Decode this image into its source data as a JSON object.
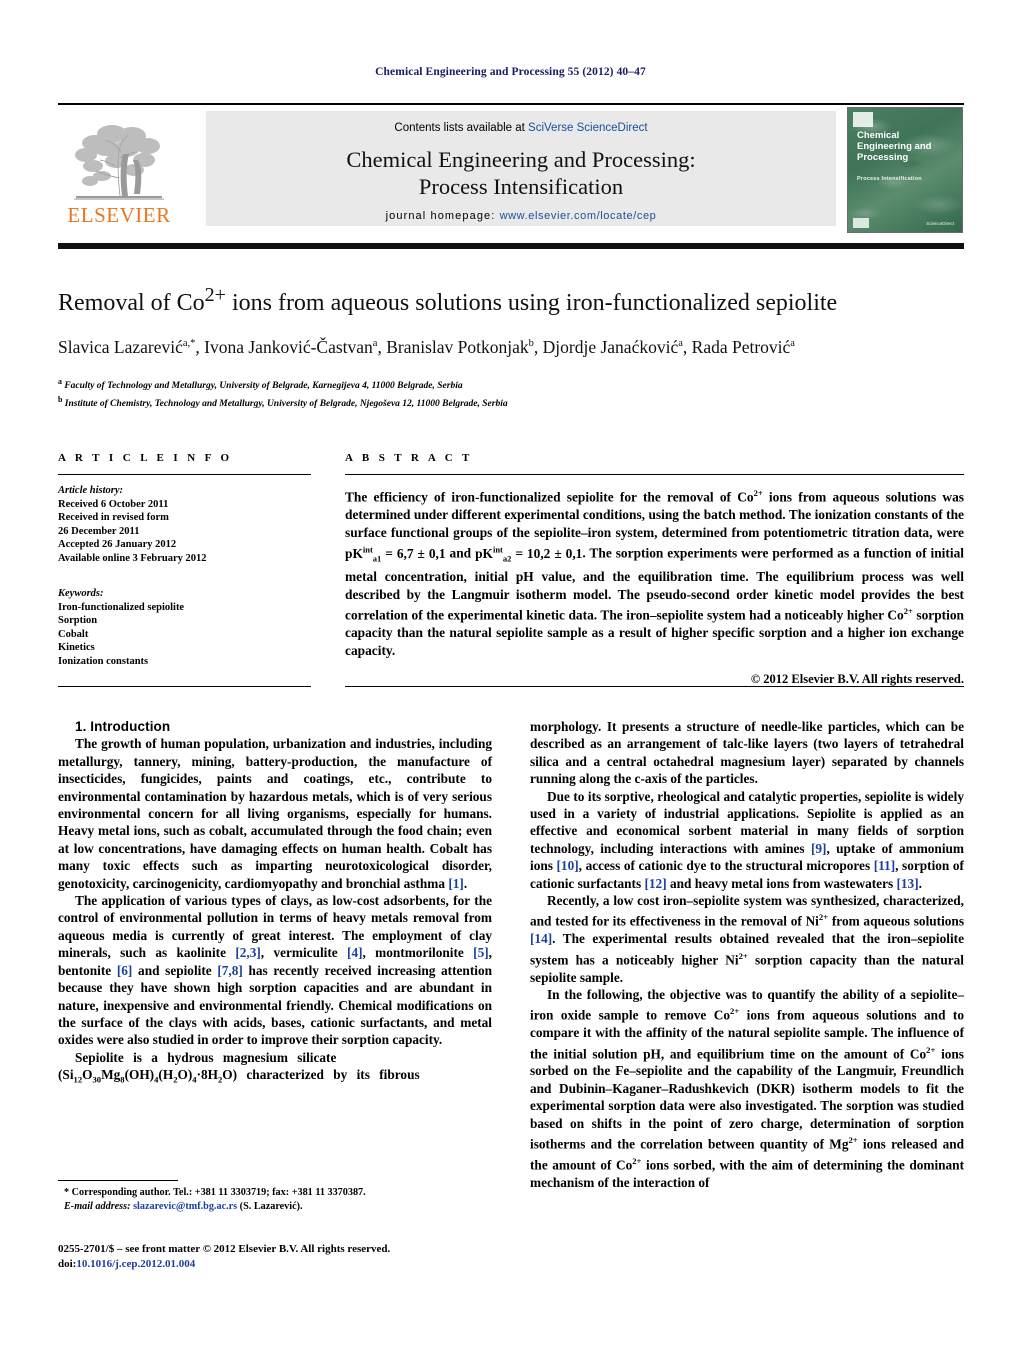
{
  "running_head": "Chemical Engineering and Processing 55 (2012) 40–47",
  "masthead": {
    "contents_prefix": "Contents lists available at ",
    "contents_link": "SciVerse ScienceDirect",
    "journal_title_line1": "Chemical Engineering and Processing:",
    "journal_title_line2": "Process Intensification",
    "homepage_label": "journal homepage:",
    "homepage_url": "www.elsevier.com/locate/cep",
    "publisher": "ELSEVIER",
    "cover": {
      "title": "Chemical Engineering and Processing",
      "subtitle": "Process Intensification",
      "footer": "ScienceDirect"
    }
  },
  "article": {
    "title_prefix": "Removal of Co",
    "title_sup": "2+",
    "title_suffix": " ions from aqueous solutions using iron-functionalized sepiolite",
    "authors": "Slavica Lazarević, Ivona Janković-Častvan, Branislav Potkonjak, Djordje Janaćković, Rada Petrović",
    "authors_html": "Slavica Lazarević a,*, Ivona Janković-Častvan a, Branislav Potkonjak b, Djordje Janaćković a, Rada Petrović a",
    "affiliation_a": "Faculty of Technology and Metallurgy, University of Belgrade, Karnegijeva 4, 11000 Belgrade, Serbia",
    "affiliation_b": "Institute of Chemistry, Technology and Metallurgy, University of Belgrade, Njegoševa 12, 11000 Belgrade, Serbia"
  },
  "info": {
    "label": "A R T I C L E    I N F O",
    "history_head": "Article history:",
    "history": [
      "Received 6 October 2011",
      "Received in revised form",
      "26 December 2011",
      "Accepted 26 January 2012",
      "Available online 3 February 2012"
    ],
    "keywords_head": "Keywords:",
    "keywords": [
      "Iron-functionalized sepiolite",
      "Sorption",
      "Cobalt",
      "Kinetics",
      "Ionization constants"
    ]
  },
  "abstract": {
    "label": "A B S T R A C T",
    "part1": "The efficiency of iron-functionalized sepiolite for the removal of Co",
    "sup1": "2+",
    "part2": " ions from aqueous solutions was determined under different experimental conditions, using the batch method. The ionization constants of the surface functional groups of the sepiolite–iron system, determined from potentiometric titration data, were ",
    "formula1": "pK",
    "formula1_sup": "int",
    "formula1_sub": "a1",
    "formula1_val": " = 6,7 ± 0,1",
    "part3": " and ",
    "formula2": "pK",
    "formula2_sup": "int",
    "formula2_sub": "a2",
    "formula2_val": " = 10,2 ± 0,1",
    "part4": ". The sorption experiments were performed as a function of initial metal concentration, initial pH value, and the equilibration time. The equilibrium process was well described by the Langmuir isotherm model. The pseudo-second order kinetic model provides the best correlation of the experimental kinetic data. The iron–sepiolite system had a noticeably higher Co",
    "sup2": "2+",
    "part5": " sorption capacity than the natural sepiolite sample as a result of higher specific sorption and a higher ion exchange capacity.",
    "copyright": "© 2012 Elsevier B.V. All rights reserved."
  },
  "introduction": {
    "heading": "1.  Introduction",
    "left_p1": "The growth of human population, urbanization and industries, including metallurgy, tannery, mining, battery-production, the manufacture of insecticides, fungicides, paints and coatings, etc., contribute to environmental contamination by hazardous metals, which is of very serious environmental concern for all living organisms, especially for humans. Heavy metal ions, such as cobalt, accumulated through the food chain; even at low concentrations, have damaging effects on human health. Cobalt has many toxic effects such as imparting neurotoxicological disorder, genotoxicity, carcinogenicity, cardiomyopathy and bronchial asthma",
    "left_p1_ref": "[1]",
    "left_p2_a": "The application of various types of clays, as low-cost adsorbents, for the control of environmental pollution in terms of heavy metals removal from aqueous media is currently of great interest. The employment of clay minerals, such as kaolinite ",
    "left_p2_r1": "[2,3]",
    "left_p2_b": ", vermiculite ",
    "left_p2_r2": "[4]",
    "left_p2_c": ", montmorilonite ",
    "left_p2_r3": "[5]",
    "left_p2_d": ", bentonite ",
    "left_p2_r4": "[6]",
    "left_p2_e": " and sepiolite ",
    "left_p2_r5": "[7,8]",
    "left_p2_f": " has recently received increasing attention because they have shown high sorption capacities and are abundant in nature, inexpensive and environmental friendly. Chemical modifications on the surface of the clays with acids, bases, cationic surfactants, and metal oxides were also studied in order to improve their sorption capacity.",
    "left_p3_a": "Sepiolite   is   a   hydrous   magnesium   silicate",
    "left_p3_formula": "(Si12O30Mg8(OH)4(H2O)4·8H2O)",
    "left_p3_b": " characterized  by  its  fibrous",
    "right_p1": "morphology. It presents a structure of needle-like particles, which can be described as an arrangement of talc-like layers (two layers of tetrahedral silica and a central octahedral magnesium layer) separated by channels running along the c-axis of the particles.",
    "right_p2_a": "Due to its sorptive, rheological and catalytic properties, sepiolite is widely used in a variety of industrial applications. Sepiolite is applied as an effective and economical sorbent material in many fields of sorption technology, including interactions with amines ",
    "right_p2_r1": "[9]",
    "right_p2_b": ", uptake of ammonium ions ",
    "right_p2_r2": "[10]",
    "right_p2_c": ", access of cationic dye to the structural micropores ",
    "right_p2_r3": "[11]",
    "right_p2_d": ", sorption of cationic surfactants ",
    "right_p2_r4": "[12]",
    "right_p2_e": " and heavy metal ions from wastewaters ",
    "right_p2_r5": "[13]",
    "right_p2_f": ".",
    "right_p3_a": "Recently, a low cost iron–sepiolite system was synthesized, characterized, and tested for its effectiveness in the removal of Ni",
    "right_p3_sup1": "2+",
    "right_p3_b": " from aqueous solutions ",
    "right_p3_r1": "[14]",
    "right_p3_c": ". The experimental results obtained revealed that the iron–sepiolite system has a noticeably higher Ni",
    "right_p3_sup2": "2+",
    "right_p3_d": " sorption capacity than the natural sepiolite sample.",
    "right_p4_a": "In the following, the objective was to quantify the ability of a sepiolite–iron oxide sample to remove Co",
    "right_p4_sup1": "2+",
    "right_p4_b": " ions from aqueous solutions and to compare it with the affinity of the natural sepiolite sample. The influence of the initial solution pH, and equilibrium time on the amount of Co",
    "right_p4_sup2": "2+",
    "right_p4_c": " ions sorbed on the Fe–sepiolite and the capability of the Langmuir, Freundlich and Dubinin–Kaganer–Radushkevich (DKR) isotherm models to fit the experimental sorption data were also investigated. The sorption was studied based on shifts in the point of zero charge, determination of sorption isotherms and the correlation between quantity of Mg",
    "right_p4_sup3": "2+",
    "right_p4_d": " ions released and the amount of Co",
    "right_p4_sup4": "2+",
    "right_p4_e": " ions sorbed, with the aim of determining the dominant mechanism of the interaction of"
  },
  "footnote": {
    "corresponding": "* Corresponding author. Tel.: +381 11 3303719; fax: +381 11 3370387.",
    "email_label": "E-mail address:",
    "email": "slazarevic@tmf.bg.ac.rs",
    "email_suffix": " (S. Lazarević)."
  },
  "footer": {
    "issn_line": "0255-2701/$ – see front matter © 2012 Elsevier B.V. All rights reserved.",
    "doi_label": "doi:",
    "doi": "10.1016/j.cep.2012.01.004"
  },
  "colors": {
    "elsevier_orange": "#E87722",
    "link_blue": "#1a4f9c",
    "ref_blue": "#1a3fa0",
    "running_head_navy": "#1a1a66",
    "band_gray": "#e9e9e9",
    "cover_green": "#3f7457"
  }
}
